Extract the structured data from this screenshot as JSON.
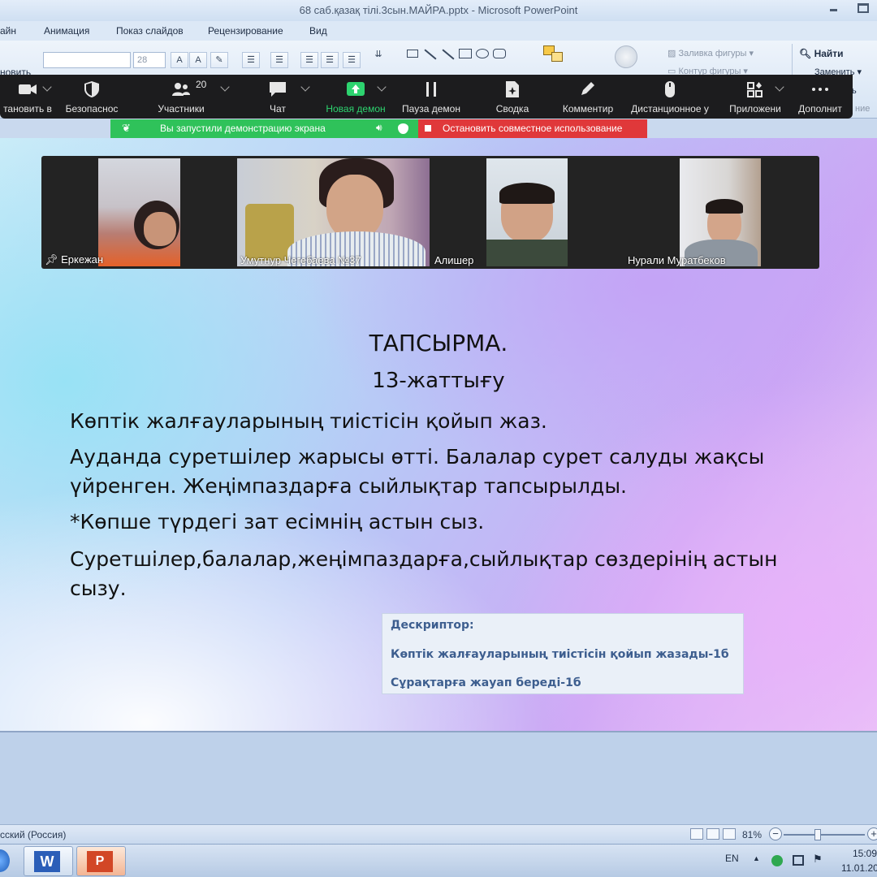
{
  "window": {
    "title": "68 саб.қазақ тілі.3сын.МАЙРА.pptx - Microsoft PowerPoint"
  },
  "ribbon": {
    "tabs": [
      "айн",
      "Анимация",
      "Показ слайдов",
      "Рецензирование",
      "Вид"
    ],
    "font_size": "28",
    "left_edge_text": "новить",
    "fill_shape": "Заливка фигуры",
    "outline_shape": "Контур фигуры",
    "find": "Найти",
    "replace": "Заменить",
    "edit_group_tail": "ние",
    "select_tail": "ь"
  },
  "zoom_toolbar": {
    "participants_count": "20",
    "items": [
      {
        "label": "тановить в",
        "icon": "video-camera-icon"
      },
      {
        "label": "Безопаснос",
        "icon": "shield-icon"
      },
      {
        "label": "Участники",
        "icon": "participants-icon"
      },
      {
        "label": "Чат",
        "icon": "chat-icon"
      },
      {
        "label": "Новая демон",
        "icon": "share-screen-icon"
      },
      {
        "label": "Пауза демон",
        "icon": "pause-icon"
      },
      {
        "label": "Сводка",
        "icon": "summary-icon"
      },
      {
        "label": "Комментир",
        "icon": "pen-icon"
      },
      {
        "label": "Дистанционное у",
        "icon": "mouse-icon"
      },
      {
        "label": "Приложени",
        "icon": "apps-icon"
      },
      {
        "label": "Дополнит",
        "icon": "more-icon"
      }
    ]
  },
  "share_banner": {
    "status": "Вы запустили демонстрацию экрана",
    "stop": "Остановить совместное использование"
  },
  "video": {
    "participants": [
      {
        "name": "Еркежан"
      },
      {
        "name": "Умутнур Чегебаева №37"
      },
      {
        "name": "Алишер"
      },
      {
        "name": "Нурали Муратбеков"
      }
    ]
  },
  "slide": {
    "heading": "ТАПСЫРМА.",
    "exercise": "13-жаттығу",
    "line1": "Көптік  жалғауларының  тиістісін қойып жаз.",
    "line2a": "Ауданда суретшілер жарысы өтті. Балалар сурет салуды жақсы",
    "line2b": "үйренген. Жеңімпаздарға сыйлықтар тапсырылды.",
    "line3": "*Көпше түрдегі зат есімнің астын сыз.",
    "line4a": "Суретшілер,балалар,жеңімпаздарға,сыйлықтар  сөздерінің астын",
    "line4b": "сызу.",
    "descriptor": {
      "title": "Дескриптор:",
      "item1": "Көптік  жалғауларының  тиістісін қойып жазады-1б",
      "item2": "Сұрақтарға жауап береді-1б"
    }
  },
  "statusbar": {
    "language": "сский (Россия)",
    "zoom": "81%"
  },
  "taskbar": {
    "input_lang": "EN",
    "time": "15:09",
    "date": "11.01.20"
  },
  "colors": {
    "zoom_toolbar_bg": "#1c1c1e",
    "share_active": "#2dd36f",
    "banner_green": "#2fc25a",
    "banner_red": "#e0383a",
    "descriptor_text": "#3d5e8f"
  }
}
